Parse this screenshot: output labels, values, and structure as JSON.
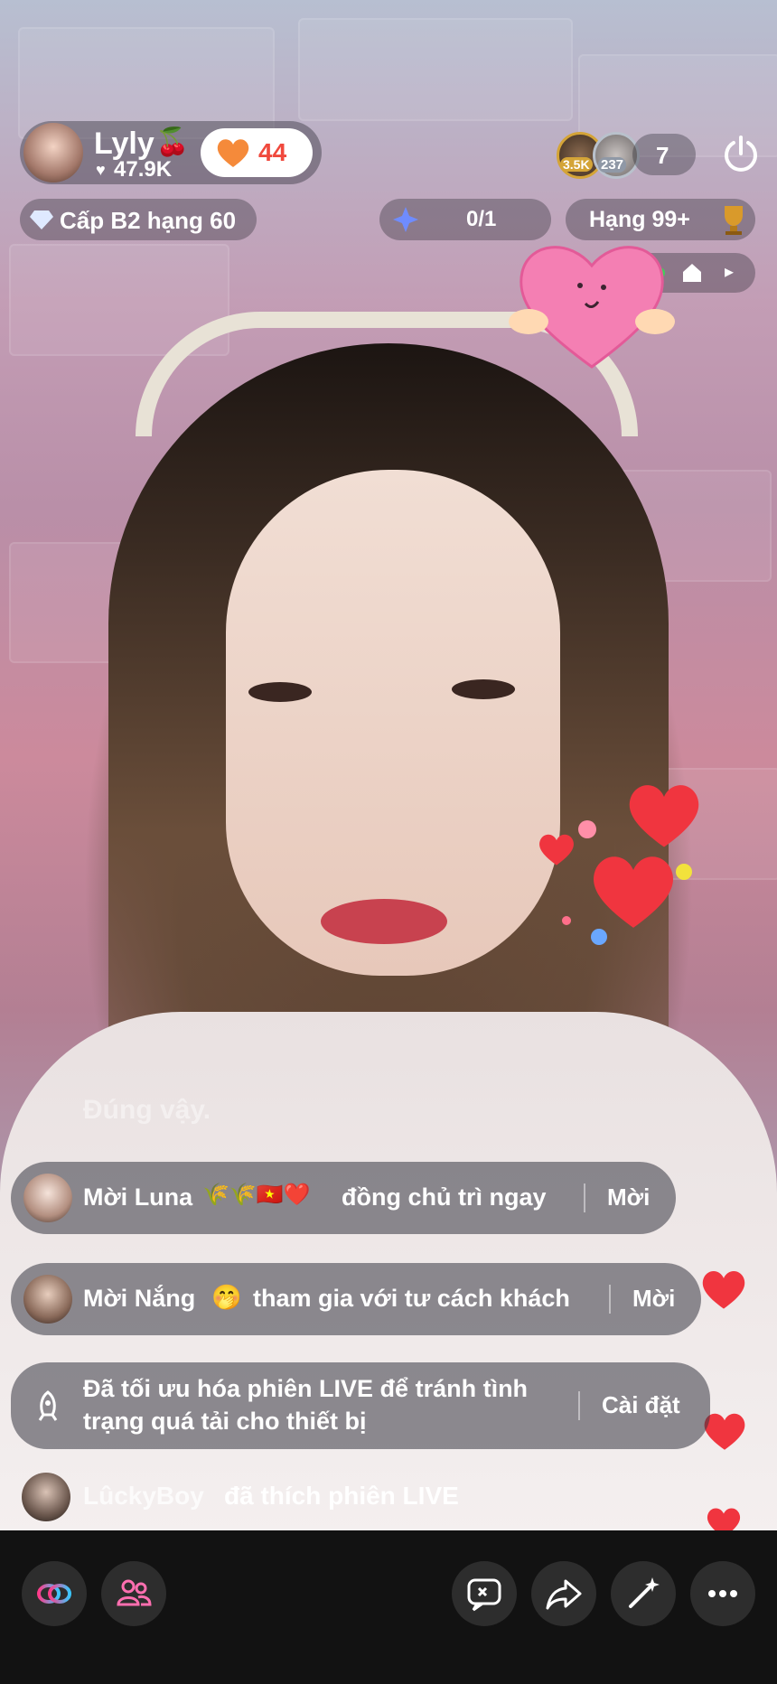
{
  "host": {
    "name": "Lyly",
    "name_emoji": "🍒",
    "likes": "47.9K",
    "hearts_count": "44"
  },
  "viewers": {
    "avatar1_badge": "3.5K",
    "avatar2_badge": "237",
    "count": "7"
  },
  "level": {
    "label": "Cấp B2 hạng 60"
  },
  "progress": {
    "value": "0/1"
  },
  "rank": {
    "label": "Hạng 99+"
  },
  "faded_message": "Đúng vậy.",
  "notifications": [
    {
      "text_prefix": "Mời Luna",
      "text_emojis": "🌾🌾🇻🇳❤️",
      "text_suffix": "đồng chủ trì ngay",
      "action": "Mời"
    },
    {
      "text_prefix": "Mời Nắng",
      "text_emoji": "🤭",
      "text_suffix": "tham gia với tư cách khách",
      "action": "Mời"
    },
    {
      "line1": "Đã tối ưu hóa phiên LIVE để tránh tình",
      "line2": "trạng quá tải cho thiết bị",
      "action": "Cài đặt"
    }
  ],
  "activity": {
    "user": "LûckyBoy",
    "text": "đã thích phiên LIVE"
  },
  "colors": {
    "heart_red": "#f0353f",
    "hearts_orange": "#f58a3a",
    "hearts_count_color": "#f0493d",
    "link_icon_gradient": "#ff3b8a",
    "guest_icon": "#ff6fb0"
  }
}
